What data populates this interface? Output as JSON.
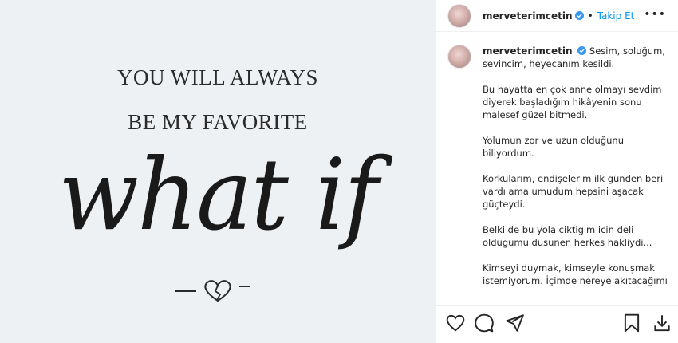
{
  "post_image": {
    "line1": "YOU WILL ALWAYS",
    "line2": "BE MY FAVORITE",
    "script": "what if"
  },
  "header": {
    "username": "merveterimcetin",
    "separator": "•",
    "follow_label": "Takip Et",
    "more": "•••"
  },
  "caption": {
    "username": "merveterimcetin",
    "first": "Sesim, soluğum, sevincim, heyecanım kesildi.",
    "paragraphs": [
      "Bu hayatta en çok anne olmayı sevdim diyerek başladığım hikâyenin sonu malesef güzel bitmedi.",
      "Yolumun zor ve uzun olduğunu biliyordum.",
      "Korkularım, endişelerim ilk günden beri vardı ama umudum hepsini aşacak güçteydi.",
      "Belki de bu yola ciktigim icin deli oldugumu dusunen herkes hakliydi...",
      "Kimseyi duymak, kimseyle konuşmak istemiyorum. İçimde nereye akıtacağımı"
    ]
  },
  "actions": [
    "heart-icon",
    "comment-icon",
    "share-icon",
    "save-icon",
    "download-icon"
  ],
  "colors": {
    "accent": "#0095f6",
    "text": "#262626",
    "image_bg": "#eef1f3"
  }
}
